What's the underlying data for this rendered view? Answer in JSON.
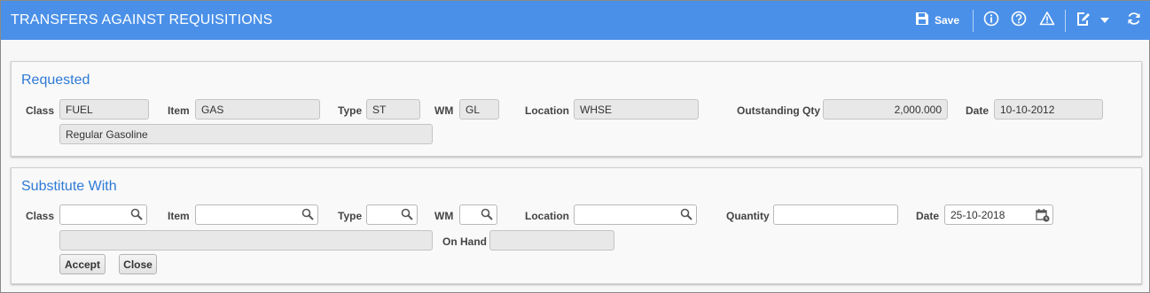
{
  "header": {
    "title": "TRANSFERS AGAINST REQUISITIONS",
    "save_label": "Save",
    "icons": [
      "save-icon",
      "info-icon",
      "help-icon",
      "warning-icon",
      "edit-icon",
      "dropdown-icon",
      "refresh-icon"
    ],
    "bg_color": "#4a90e8"
  },
  "requested": {
    "title": "Requested",
    "class_label": "Class",
    "class_value": "FUEL",
    "item_label": "Item",
    "item_value": "GAS",
    "type_label": "Type",
    "type_value": "ST",
    "wm_label": "WM",
    "wm_value": "GL",
    "location_label": "Location",
    "location_value": "WHSE",
    "qty_label": "Outstanding Qty",
    "qty_value": "2,000.000",
    "date_label": "Date",
    "date_value": "10-10-2012",
    "description": "Regular Gasoline"
  },
  "substitute": {
    "title": "Substitute With",
    "class_label": "Class",
    "class_value": "",
    "item_label": "Item",
    "item_value": "",
    "type_label": "Type",
    "type_value": "",
    "wm_label": "WM",
    "wm_value": "",
    "location_label": "Location",
    "location_value": "",
    "quantity_label": "Quantity",
    "quantity_value": "",
    "date_label": "Date",
    "date_value": "25-10-2018",
    "description": "",
    "onhand_label": "On Hand",
    "onhand_value": "",
    "accept_label": "Accept",
    "close_label": "Close"
  }
}
